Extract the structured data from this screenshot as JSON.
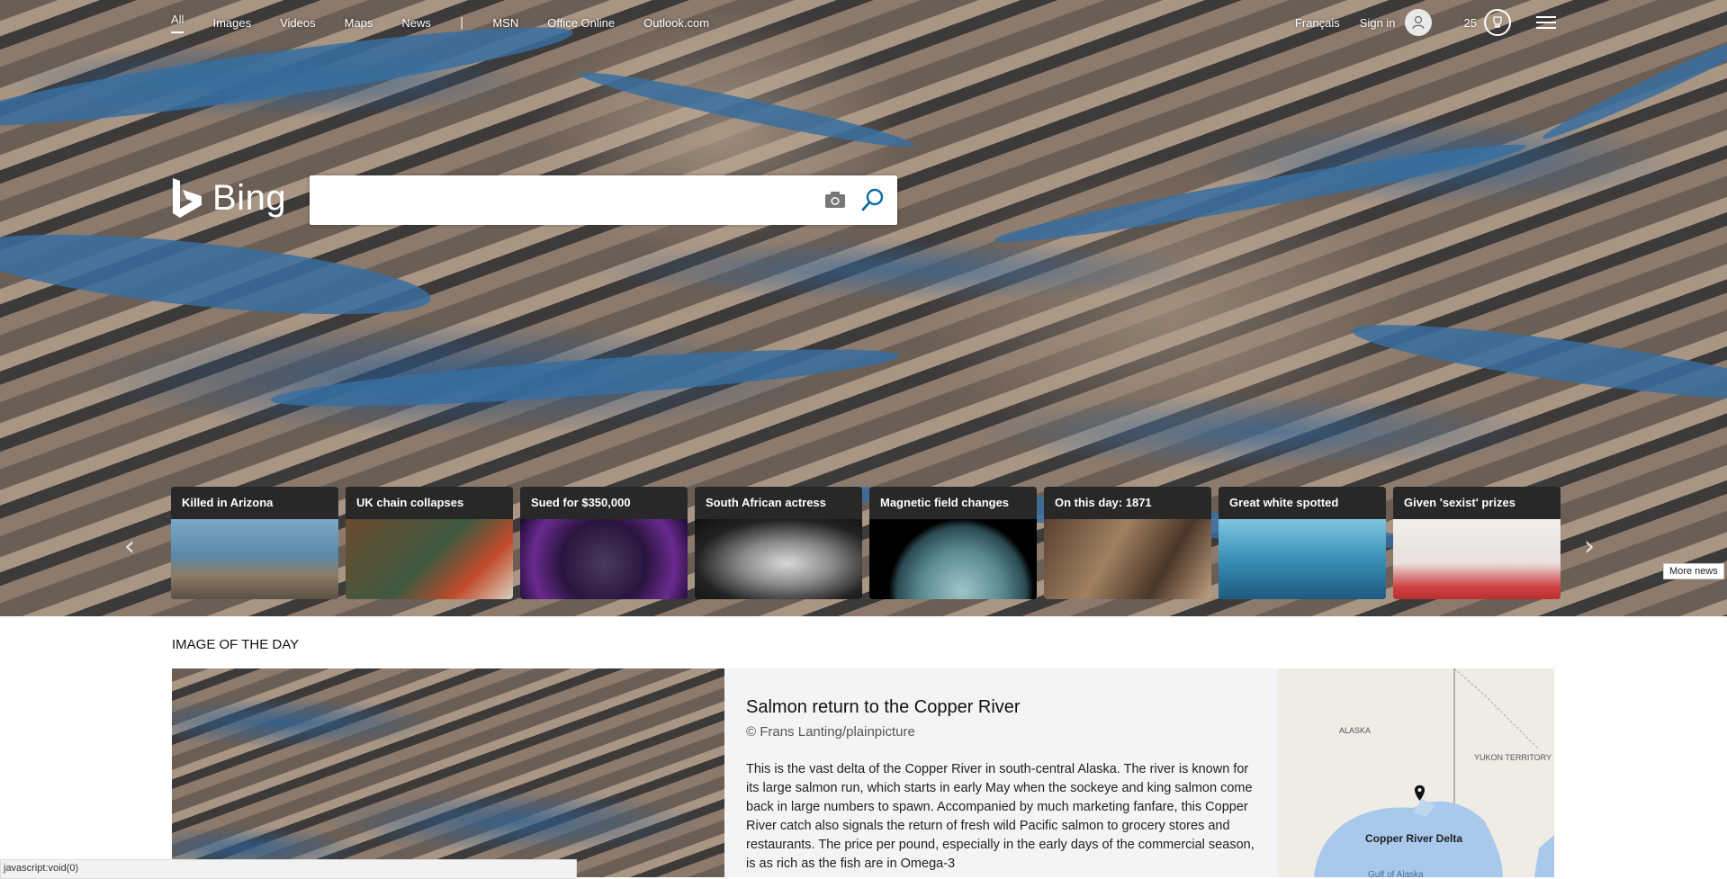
{
  "nav": {
    "items": [
      {
        "label": "All",
        "active": true
      },
      {
        "label": "Images"
      },
      {
        "label": "Videos"
      },
      {
        "label": "Maps"
      },
      {
        "label": "News"
      }
    ],
    "separator": "|",
    "links": [
      {
        "label": "MSN"
      },
      {
        "label": "Office Online"
      },
      {
        "label": "Outlook.com"
      }
    ],
    "language": "Français",
    "sign_in": "Sign in",
    "rewards_count": "25",
    "menu_icon": "hamburger-menu-icon"
  },
  "logo": {
    "text": "Bing",
    "icon": "bing-logo-icon"
  },
  "search": {
    "value": "",
    "placeholder": "",
    "camera_icon": "camera-icon",
    "search_icon": "search-icon"
  },
  "news": {
    "cards": [
      {
        "title": "Killed in Arizona"
      },
      {
        "title": "UK chain collapses"
      },
      {
        "title": "Sued for $350,000"
      },
      {
        "title": "South African actress"
      },
      {
        "title": "Magnetic field changes"
      },
      {
        "title": "On this day: 1871"
      },
      {
        "title": "Great white spotted"
      },
      {
        "title": "Given 'sexist' prizes"
      }
    ],
    "more_label": "More news"
  },
  "image_of_the_day": {
    "heading": "IMAGE OF THE DAY",
    "title": "Salmon return to the Copper River",
    "copyright": "© Frans Lanting/plainpicture",
    "description": "This is the vast delta of the Copper River in south-central Alaska. The river is known for its large salmon run, which starts in early May when the sockeye and king salmon come back in large numbers to spawn. Accompanied by much marketing fanfare, this Copper River catch also signals the return of fresh wild Pacific salmon to grocery stores and restaurants. The price per pound, especially in the early days of the commercial season, is as rich as the fish are in Omega-3",
    "map": {
      "labels": [
        "ALASKA",
        "YUKON TERRITORY",
        "Copper River Delta",
        "Gulf of Alaska"
      ]
    }
  },
  "status_bar": {
    "text": "javascript:void(0)"
  }
}
